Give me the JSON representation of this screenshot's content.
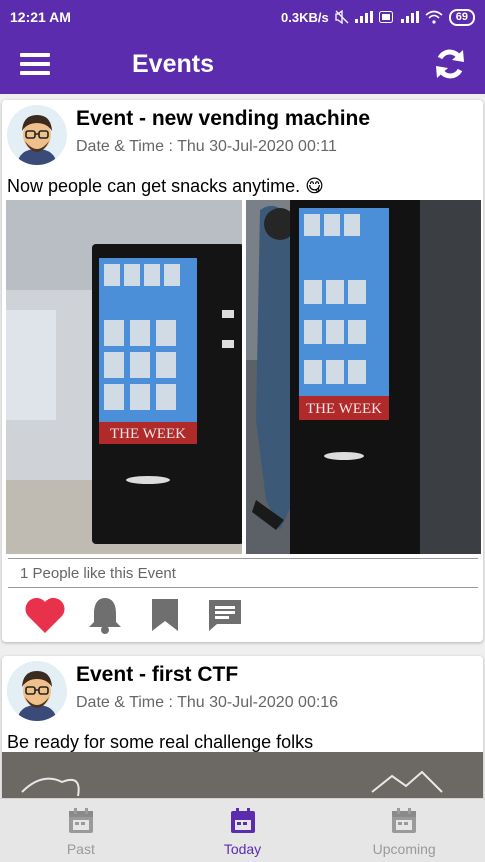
{
  "status_bar": {
    "time": "12:21 AM",
    "network_speed": "0.3KB/s",
    "battery": "69"
  },
  "app_bar": {
    "title": "Events",
    "menu_icon": "hamburger-menu-icon",
    "refresh_icon": "refresh-icon"
  },
  "events": [
    {
      "title": "Event - new vending machine",
      "date": "Date & Time : Thu 30-Jul-2020 00:11",
      "description": "Now people can get snacks anytime. 😋",
      "likes": "1 People like this Event",
      "image_caption": "THE WEEK"
    },
    {
      "title": "Event - first CTF",
      "date": "Date & Time : Thu 30-Jul-2020 00:16",
      "description": "Be ready for some real challenge folks"
    }
  ],
  "actions": [
    {
      "icon": "heart-icon",
      "color": "#e8314b"
    },
    {
      "icon": "bell-icon",
      "color": "#6f6f6f"
    },
    {
      "icon": "bookmark-icon",
      "color": "#6f6f6f"
    },
    {
      "icon": "comment-icon",
      "color": "#6f6f6f"
    }
  ],
  "bottom_nav": {
    "items": [
      {
        "label": "Past",
        "icon": "calendar-icon",
        "active": false
      },
      {
        "label": "Today",
        "icon": "calendar-icon",
        "active": true
      },
      {
        "label": "Upcoming",
        "icon": "calendar-icon",
        "active": false
      }
    ]
  },
  "colors": {
    "primary": "#5b2dae",
    "like": "#e8314b",
    "inactive": "#9a9a9a"
  }
}
